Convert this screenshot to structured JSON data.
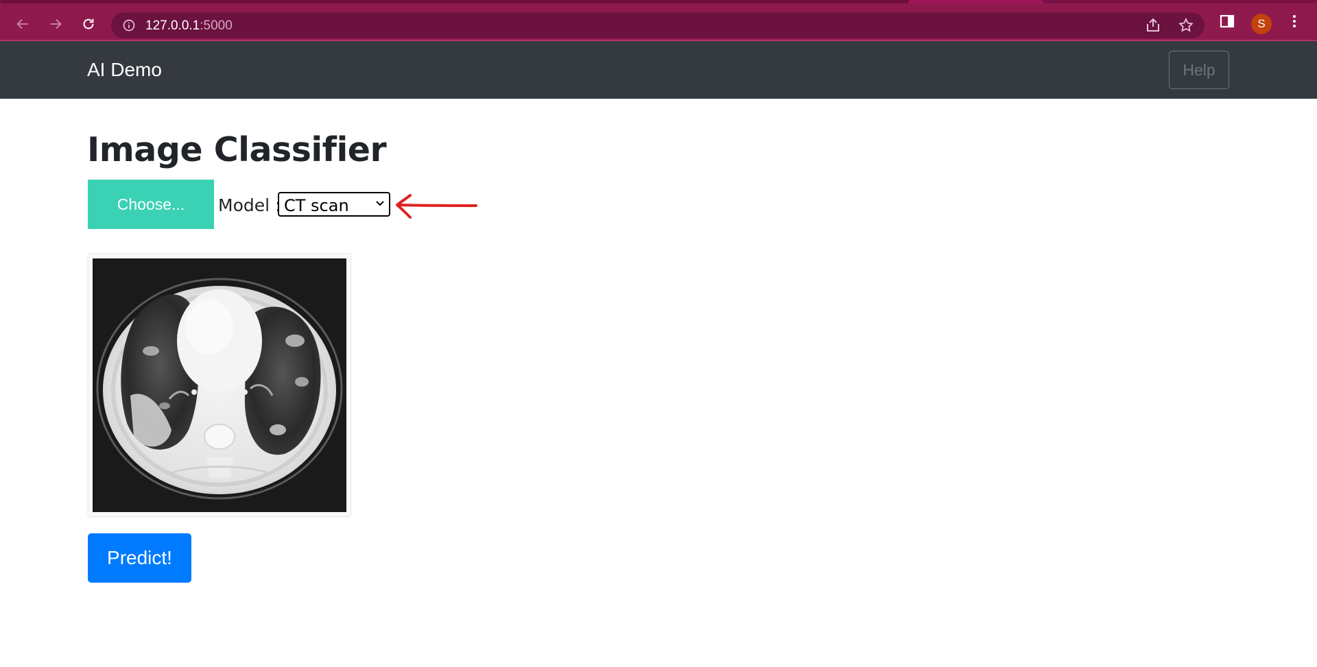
{
  "browser": {
    "url_host": "127.0.0.1",
    "url_port": ":5000",
    "profile_initial": "S",
    "theme_color": "#8e1a4d"
  },
  "navbar": {
    "brand": "AI Demo",
    "help_label": "Help",
    "background": "#343a40"
  },
  "main": {
    "title": "Image Classifier",
    "choose_label": "Choose...",
    "model_label": "Model :",
    "model_selected": "CT scan",
    "predict_label": "Predict!",
    "choose_color": "#3ad1b4",
    "predict_color": "#007bff"
  },
  "icons": {
    "back": "arrow-left-icon",
    "forward": "arrow-right-icon",
    "reload": "reload-icon",
    "info": "info-icon",
    "share": "share-icon",
    "bookmark": "star-icon",
    "side_panel": "side-panel-icon",
    "menu": "kebab-menu-icon",
    "annotation": "red-arrow-annotation",
    "select": "chevron-down-icon"
  }
}
